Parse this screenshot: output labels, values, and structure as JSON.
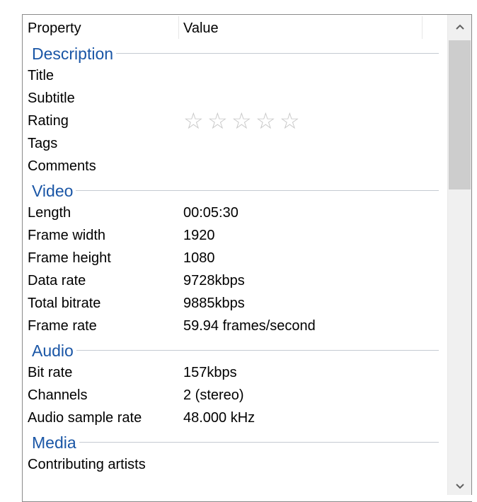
{
  "header": {
    "property": "Property",
    "value": "Value"
  },
  "sections": [
    {
      "title": "Description",
      "rows": [
        {
          "property": "Title",
          "value": ""
        },
        {
          "property": "Subtitle",
          "value": ""
        },
        {
          "property": "Rating",
          "value": "",
          "rating_stars_filled": 0,
          "rating_stars_total": 5
        },
        {
          "property": "Tags",
          "value": ""
        },
        {
          "property": "Comments",
          "value": ""
        }
      ]
    },
    {
      "title": "Video",
      "rows": [
        {
          "property": "Length",
          "value": "00:05:30"
        },
        {
          "property": "Frame width",
          "value": "1920"
        },
        {
          "property": "Frame height",
          "value": "1080"
        },
        {
          "property": "Data rate",
          "value": "9728kbps"
        },
        {
          "property": "Total bitrate",
          "value": "9885kbps"
        },
        {
          "property": "Frame rate",
          "value": "59.94 frames/second"
        }
      ]
    },
    {
      "title": "Audio",
      "rows": [
        {
          "property": "Bit rate",
          "value": "157kbps"
        },
        {
          "property": "Channels",
          "value": "2 (stereo)"
        },
        {
          "property": "Audio sample rate",
          "value": "48.000 kHz"
        }
      ]
    },
    {
      "title": "Media",
      "rows": [
        {
          "property": "Contributing artists",
          "value": ""
        }
      ]
    }
  ],
  "scrollbar": {
    "up_icon": "chevron-up-icon",
    "down_icon": "chevron-down-icon"
  },
  "colors": {
    "section_title": "#1a56a6",
    "star_empty": "#c6c6c6"
  }
}
